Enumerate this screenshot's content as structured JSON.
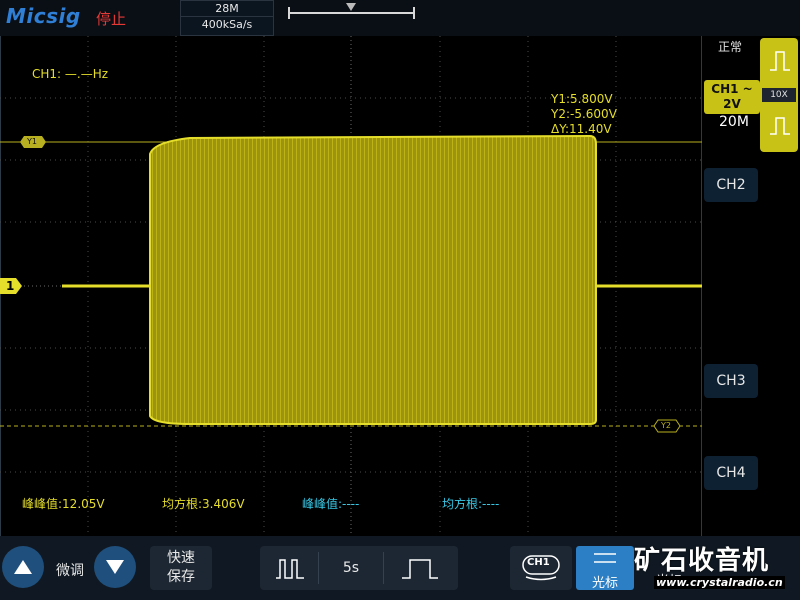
{
  "topbar": {
    "logo": "Micsig",
    "run_state": "停止",
    "memory_depth": "28M",
    "sample_rate": "400kSa/s"
  },
  "screen": {
    "ch1_freq": "CH1: —.—Hz",
    "cursor_y1": "Y1:5.800V",
    "cursor_y2": "Y2:-5.600V",
    "cursor_dy": "ΔY:11.40V",
    "y1_tag": "Y1",
    "y2_tag": "Y2",
    "ch1_marker": "1",
    "measurements": [
      {
        "label": "峰峰值:12.05V",
        "color": "#e5de2a"
      },
      {
        "label": "均方根:3.406V",
        "color": "#e5de2a"
      },
      {
        "label": "峰峰值:----",
        "color": "#38c8e6"
      },
      {
        "label": "均方根:----",
        "color": "#38c8e6"
      }
    ]
  },
  "right_panel": {
    "trigger_mode": "正常",
    "ch1_name": "CH1 ~",
    "ch1_scale": "2V",
    "bandwidth": "20M",
    "probe": "10X",
    "channels": [
      "CH2",
      "CH3",
      "CH4"
    ]
  },
  "bottombar": {
    "fine_label": "微调",
    "quick_save_line1": "快速",
    "quick_save_line2": "保存",
    "timebase": "5s",
    "ch1_button": "CH1",
    "cursor_label": "光标",
    "trigger_label": "光标",
    "watermark": "矿石收音机",
    "watermark_url": "www.crystalradio.cn"
  },
  "colors": {
    "ch1": "#e5de2a",
    "ch2": "#38c8e6",
    "accent": "#2c7fc4",
    "run_state": "#e53935",
    "logo": "#2f7fd6"
  }
}
